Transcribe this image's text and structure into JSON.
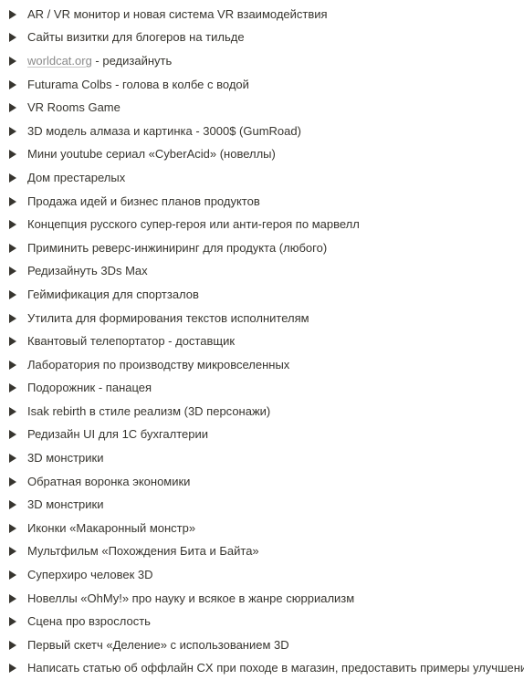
{
  "toggle_list": {
    "items": [
      {
        "text": "AR / VR монитор и новая система VR взаимодействия"
      },
      {
        "text": "Сайты визитки для блогеров на тильде"
      },
      {
        "link": "worldcat.org",
        "text": " - редизайнуть"
      },
      {
        "text": "Futurama Colbs - голова в колбе с водой"
      },
      {
        "text": "VR Rooms Game"
      },
      {
        "text": "3D модель алмаза и картинка - 3000$ (GumRoad)"
      },
      {
        "text": "Мини youtube сериал «CyberAcid» (новеллы)"
      },
      {
        "text": "Дом престарелых"
      },
      {
        "text": "Продажа идей и бизнес планов продуктов"
      },
      {
        "text": "Концепция русского супер-героя или анти-героя по марвелл"
      },
      {
        "text": "Приминить реверс-инжиниринг для продукта (любого)"
      },
      {
        "text": "Редизайнуть 3Ds Max"
      },
      {
        "text": "Геймификация для спортзалов"
      },
      {
        "text": "Утилита для формирования текстов исполнителям"
      },
      {
        "text": "Квантовый телепортатор - доставщик"
      },
      {
        "text": "Лаборатория по производству микровселенных"
      },
      {
        "text": "Подорожник - панацея"
      },
      {
        "text": "Isak rebirth в стиле реализм (3D персонажи)"
      },
      {
        "text": "Редизайн UI для 1С бухгалтерии"
      },
      {
        "text": "3D монстрики"
      },
      {
        "text": "Обратная воронка экономики"
      },
      {
        "text": "3D монстрики"
      },
      {
        "text": "Иконки «Макаронный монстр»"
      },
      {
        "text": "Мультфильм «Похождения Бита и Байта»"
      },
      {
        "text": "Суперхиро человек 3D"
      },
      {
        "text": "Новеллы «OhMy!» про науку и всякое в жанре сюрриализм"
      },
      {
        "text": "Сцена про взрослость"
      },
      {
        "text": "Первый скетч «Деление» с использованием 3D"
      },
      {
        "text": "Написать статью об оффлайн CX при походе в магазин, предоставить примеры улучшений"
      }
    ],
    "arrow_icon": "triangle-right-icon",
    "colors": {
      "text": "#37352f",
      "arrow": "#37352f",
      "link": "#8a8a8a"
    }
  }
}
